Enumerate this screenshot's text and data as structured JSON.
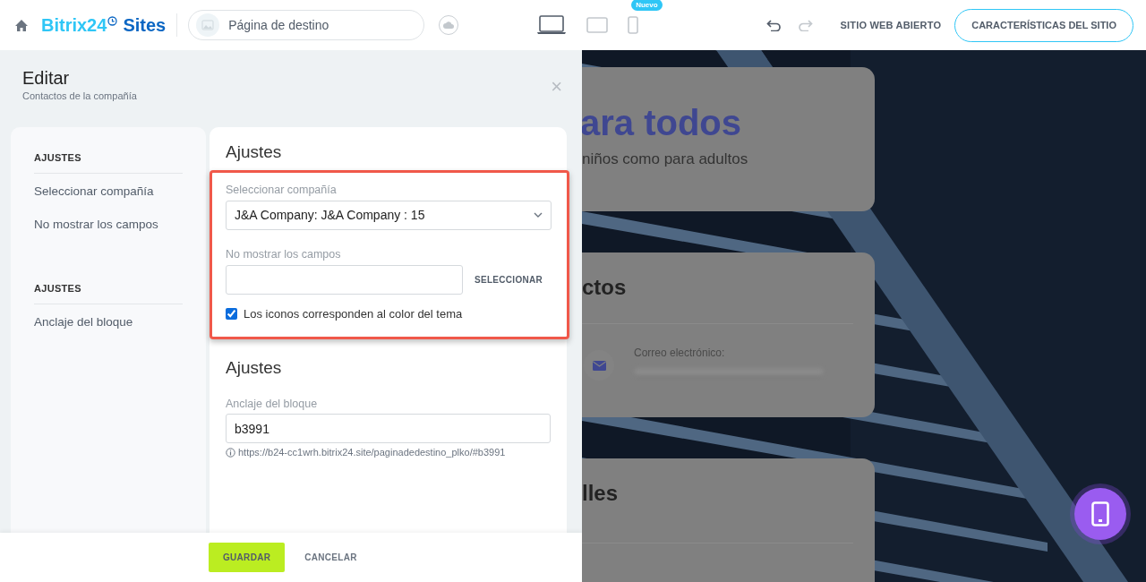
{
  "header": {
    "logo": {
      "brand": "Bitrix24",
      "product": "Sites"
    },
    "page_field": {
      "value": "Página de destino"
    },
    "devices": [
      {
        "kind": "laptop",
        "selected": true
      },
      {
        "kind": "tablet",
        "selected": false
      },
      {
        "kind": "phone",
        "selected": false,
        "badge": "Nuevo"
      }
    ],
    "undo": {
      "disabled": false
    },
    "redo": {
      "disabled": true
    },
    "open_site_link": "SITIO WEB ABIERTO",
    "features_button": "CARACTERÍSTICAS DEL SITIO"
  },
  "editor": {
    "title": "Editar",
    "subtitle": "Contactos de la compañía",
    "close_button": "×",
    "nav": [
      {
        "heading": "AJUSTES",
        "items": [
          "Seleccionar compañía",
          "No mostrar los campos"
        ]
      },
      {
        "heading": "AJUSTES",
        "items": [
          "Anclaje del bloque"
        ]
      }
    ],
    "sections": [
      {
        "title": "Ajustes",
        "highlighted": true,
        "fields": [
          {
            "kind": "select",
            "label": "Seleccionar compañía",
            "value": "J&A Company: J&A Company : 15"
          },
          {
            "kind": "picker",
            "label": "No mostrar los campos",
            "button": "SELECCIONAR"
          },
          {
            "kind": "checkbox",
            "label": "Los iconos corresponden al color del tema",
            "checked": true
          }
        ]
      },
      {
        "title": "Ajustes",
        "fields": [
          {
            "kind": "text",
            "label": "Anclaje del bloque",
            "value": "b3991",
            "hint": "https://b24-cc1wrh.bitrix24.site/paginadedestino_plko/#b3991"
          }
        ]
      }
    ],
    "buttons": {
      "save": "GUARDAR",
      "cancel": "CANCELAR"
    }
  },
  "preview": {
    "blocks": [
      {
        "kind": "hero",
        "title": "ara todos",
        "text": "niños como para adultos"
      },
      {
        "kind": "contacts",
        "title": "ctos",
        "items": [
          {
            "label": "Correo electrónico:"
          }
        ]
      },
      {
        "kind": "details",
        "title": "lles"
      }
    ]
  }
}
